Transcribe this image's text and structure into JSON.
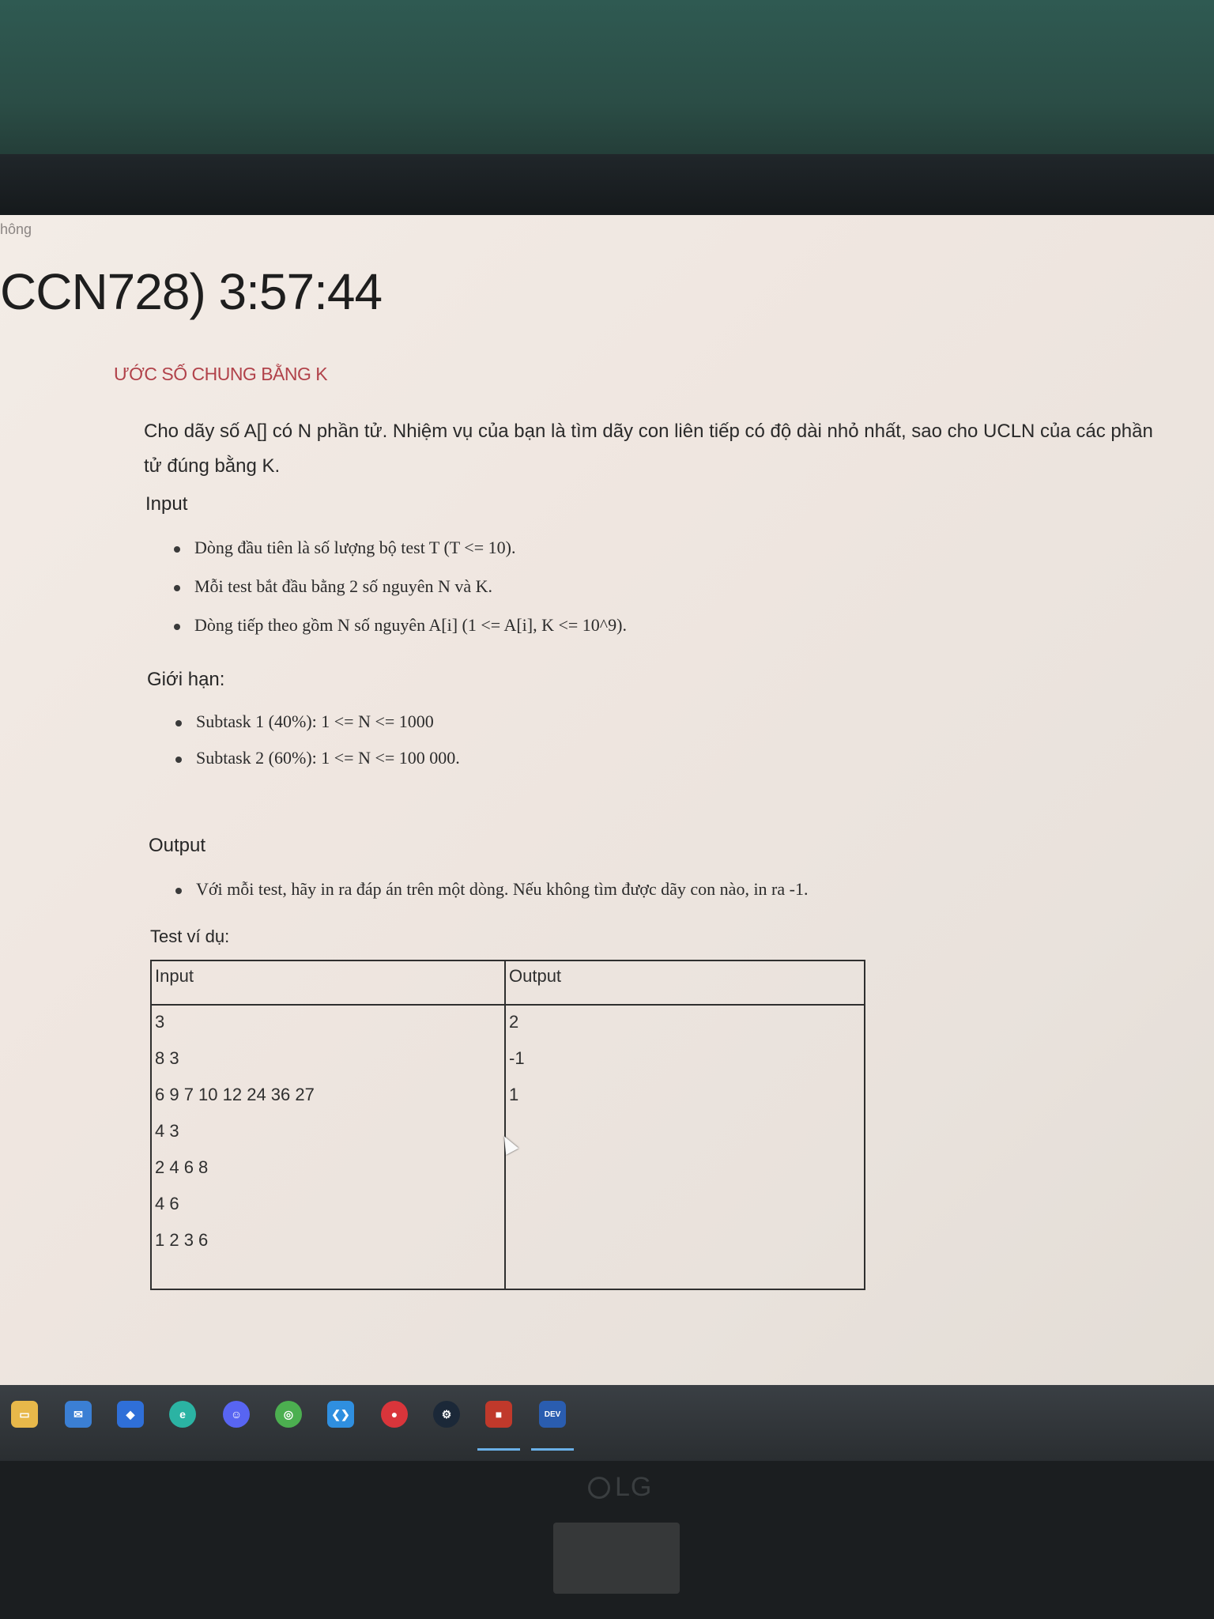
{
  "page": {
    "breadcrumb": "hông",
    "timer_title": "CCN728) 3:57:44",
    "problem_title": "ƯỚC SỐ CHUNG BẰNG K",
    "statement": "Cho dãy số A[] có N phần tử. Nhiệm vụ của bạn là tìm dãy con liên tiếp có độ dài nhỏ nhất, sao cho UCLN của các phần tử đúng bằng K.",
    "input_heading": "Input",
    "input_items": [
      "Dòng đầu tiên là số lượng bộ test T (T <= 10).",
      "Mỗi test bắt đầu bằng 2 số nguyên N và K.",
      "Dòng tiếp theo gồm N số nguyên A[i] (1 <= A[i], K <= 10^9)."
    ],
    "limits_heading": "Giới hạn:",
    "limit_items": [
      "Subtask 1 (40%): 1 <= N <= 1000",
      "Subtask 2 (60%): 1 <= N <= 100 000."
    ],
    "output_heading": "Output",
    "output_items": [
      "Với mỗi test, hãy in ra đáp án trên một dòng. Nếu không tìm được dãy con nào, in ra -1."
    ],
    "example_heading": "Test ví dụ:",
    "example_table": {
      "input_header": "Input",
      "output_header": "Output",
      "input_lines": [
        "3",
        "8 3",
        "6 9 7 10 12 24 36 27",
        "4 3",
        "2 4 6 8",
        "4 6",
        "1 2 3 6"
      ],
      "output_lines": [
        "2",
        "-1",
        "1"
      ]
    }
  },
  "taskbar": {
    "icons": [
      {
        "name": "file-explorer-icon",
        "color": "#e8b84a"
      },
      {
        "name": "mail-icon",
        "color": "#3b7fd4"
      },
      {
        "name": "dropbox-icon",
        "color": "#2f6fd8"
      },
      {
        "name": "edge-icon",
        "color": "#2bb3a3"
      },
      {
        "name": "discord-icon",
        "color": "#5865f2"
      },
      {
        "name": "chrome-icon",
        "color": "#4caf50"
      },
      {
        "name": "vscode-icon",
        "color": "#2f8fe0"
      },
      {
        "name": "app-red-icon",
        "color": "#d9353b"
      },
      {
        "name": "steam-icon",
        "color": "#1b2838"
      },
      {
        "name": "app-window-icon",
        "color": "#c0392b"
      },
      {
        "name": "devcpp-icon",
        "color": "#2a5db0",
        "label": "DEV C++"
      }
    ]
  },
  "monitor": {
    "brand": "LG"
  }
}
